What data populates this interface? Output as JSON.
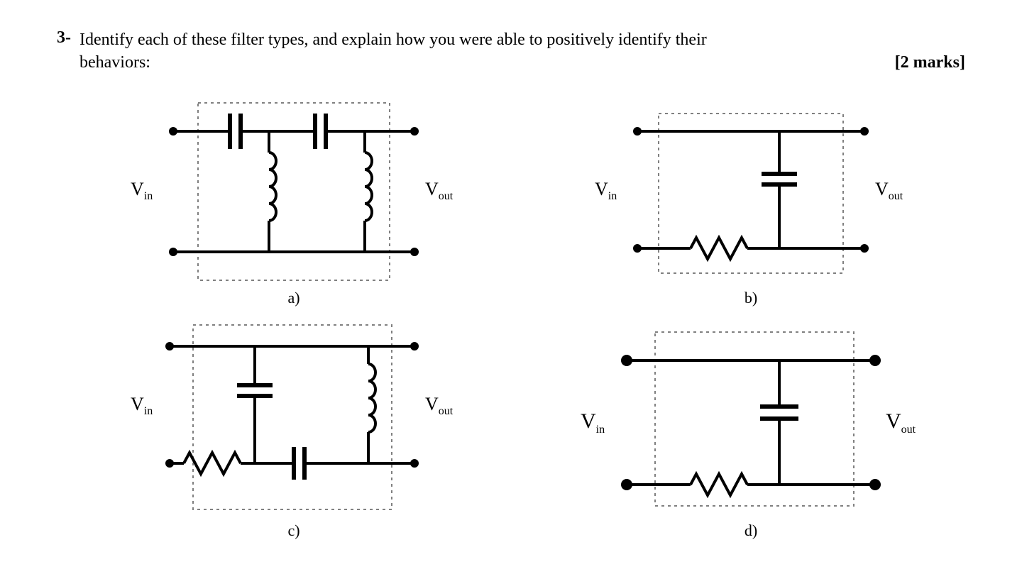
{
  "question": {
    "number": "3-",
    "text_line1": "Identify each of these filter types, and explain how you were able to positively identify their",
    "text_line2": "behaviors:",
    "marks": "[2 marks]"
  },
  "labels": {
    "Vin": "V",
    "Vin_sub": "in",
    "Vout": "V",
    "Vout_sub": "out"
  },
  "circuit_labels": {
    "a": "a)",
    "b": "b)",
    "c": "c)",
    "d": "d)"
  }
}
